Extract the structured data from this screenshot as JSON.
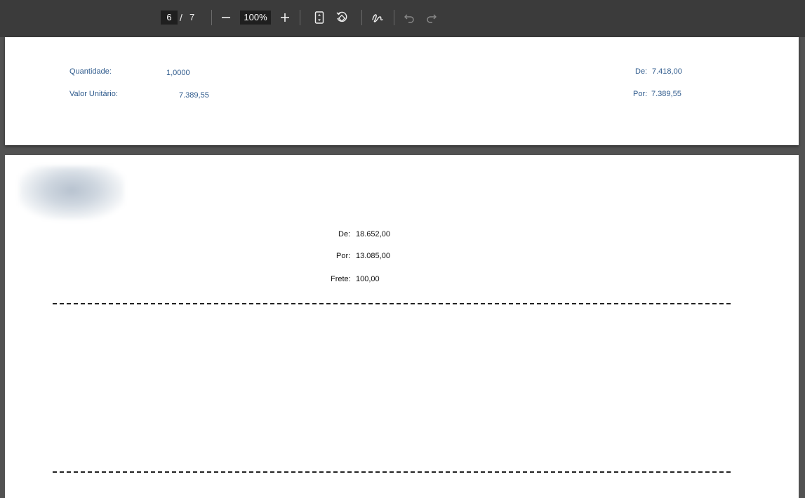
{
  "toolbar": {
    "page_current": "6",
    "page_separator": "/",
    "page_total": "7",
    "zoom": "100%",
    "icons": [
      "zoom-out-icon",
      "zoom-in-icon",
      "fit-page-icon",
      "rotate-icon",
      "draw-icon",
      "undo-icon",
      "redo-icon"
    ]
  },
  "page1": {
    "quantidade_label": "Quantidade:",
    "quantidade_value": "1,0000",
    "valor_label": "Valor Unitário:",
    "valor_value": "7.389,55",
    "de_label": "De:",
    "de_value": "7.418,00",
    "por_label": "Por:",
    "por_value": "7.389,55"
  },
  "page2": {
    "de_label": "De:",
    "de_value": "18.652,00",
    "por_label": "Por:",
    "por_value": "13.085,00",
    "frete_label": "Frete:",
    "frete_value": "100,00"
  },
  "colors": {
    "toolbar_bg": "#3b3b3b",
    "viewer_bg": "#525252",
    "blue_text": "#2e5a8c"
  }
}
